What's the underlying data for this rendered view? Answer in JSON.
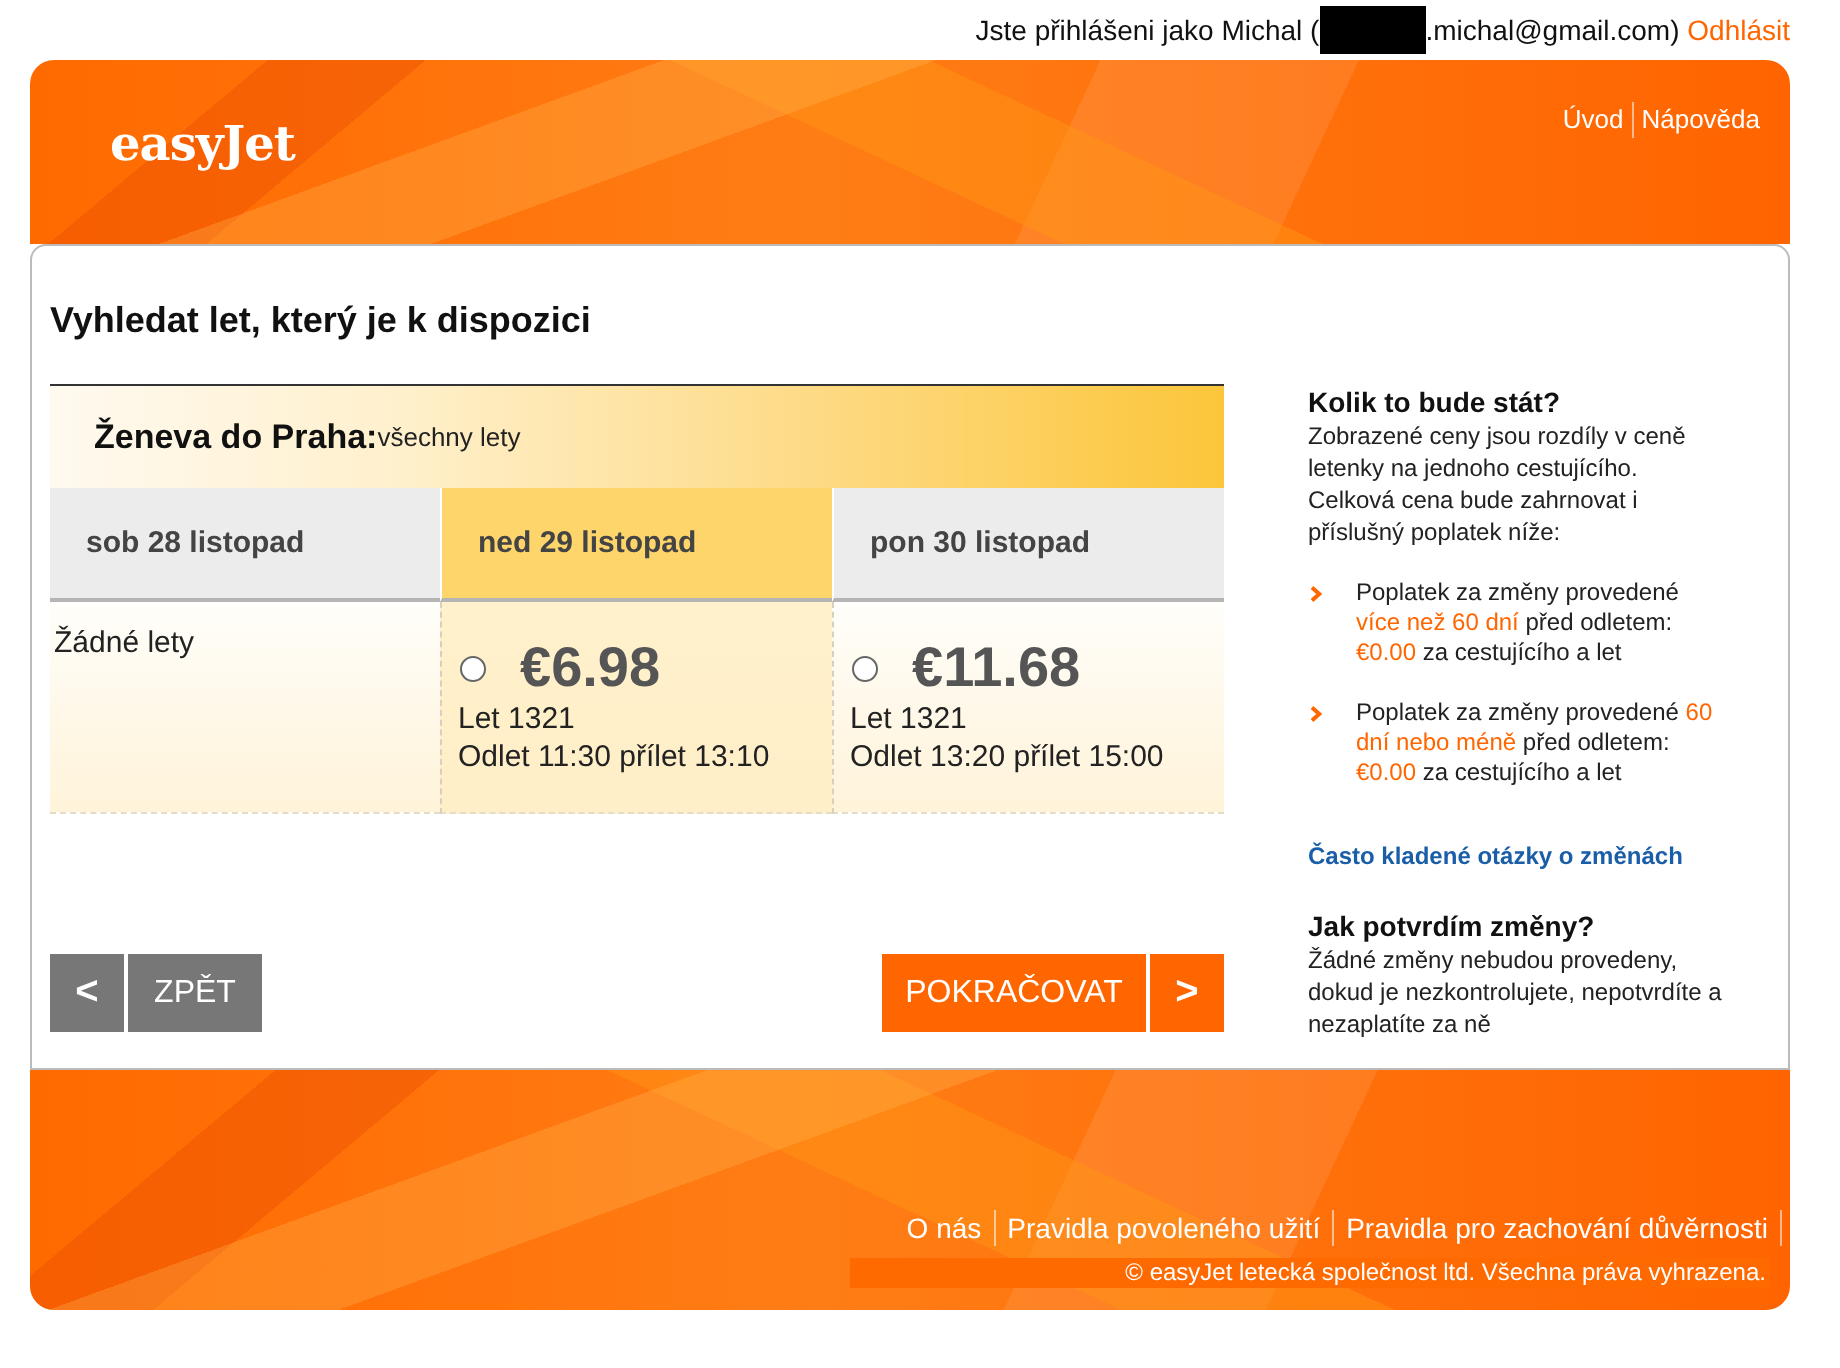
{
  "account_bar": {
    "prefix": "Jste přihlášeni jako Michal (",
    "redacted": true,
    "suffix": ".michal@gmail.com)",
    "logout": "Odhlásit"
  },
  "header": {
    "logo": "easyJet",
    "nav": [
      "Úvod",
      "Nápověda"
    ]
  },
  "main": {
    "title": "Vyhledat let, který je k dispozici",
    "route": {
      "name": "Ženeva do Praha:",
      "note": "všechny lety"
    },
    "days": [
      {
        "label": "sob 28 listopad",
        "selected": false,
        "kind": "none",
        "message": "Žádné lety"
      },
      {
        "label": "ned 29 listopad",
        "selected": true,
        "kind": "flight",
        "flight": {
          "selected": false,
          "price": "€6.98",
          "number": "Let 1321",
          "times": "Odlet 11:30 přílet 13:10"
        }
      },
      {
        "label": "pon 30 listopad",
        "selected": false,
        "kind": "flight",
        "flight": {
          "selected": false,
          "price": "€11.68",
          "number": "Let 1321",
          "times": "Odlet 13:20 přílet 15:00"
        }
      }
    ]
  },
  "navigation": {
    "back": {
      "arrow": "<",
      "label": "ZPĚT"
    },
    "next": {
      "label": "POKRAČOVAT",
      "arrow": ">"
    }
  },
  "sidebar": {
    "price_heading": "Kolik to bude stát?",
    "price_text": [
      "Zobrazené ceny jsou rozdíly v ceně letenky na jednoho cestujícího.",
      "Celková cena bude zahrnovat i příslušný poplatek níže:"
    ],
    "fees": [
      [
        {
          "text": "Poplatek za změny provedené ",
          "highlight": false
        },
        {
          "text": "více než 60 dní",
          "highlight": true
        },
        {
          "text": " před odletem: ",
          "highlight": false
        },
        {
          "text": "€0.00",
          "highlight": true
        },
        {
          "text": " za cestujícího a let",
          "highlight": false
        }
      ],
      [
        {
          "text": "Poplatek za změny provedené ",
          "highlight": false
        },
        {
          "text": "60 dní nebo méně",
          "highlight": true
        },
        {
          "text": " před odletem: ",
          "highlight": false
        },
        {
          "text": "€0.00",
          "highlight": true
        },
        {
          "text": " za cestujícího a let",
          "highlight": false
        }
      ]
    ],
    "faq_link": "Často kladené otázky o změnách",
    "confirm_heading": "Jak potvrdím změny?",
    "confirm_text": "Žádné změny nebudou provedeny, dokud je nezkontrolujete, nepotvrdíte a nezaplatíte za ně"
  },
  "footer": {
    "links": [
      "O nás",
      "Pravidla povoleného užití",
      "Pravidla pro zachování důvěrnosti"
    ],
    "copyright": "© easyJet letecká společnost ltd. Všechna práva vyhrazena."
  }
}
